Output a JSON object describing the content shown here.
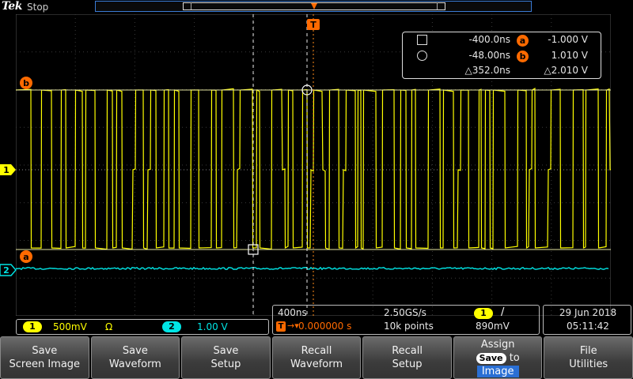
{
  "header": {
    "logo": "Tek",
    "run_state": "Stop"
  },
  "colors": {
    "ch1": "#ffff00",
    "ch2": "#00e5e5",
    "cursor_accent": "#ff6a00",
    "record_view_border": "#3a7bd5",
    "image_chip": "#2a6fd4"
  },
  "markers": {
    "trigger_label": "T",
    "cursor_a_label": "a",
    "cursor_b_label": "b",
    "ch1_label": "1",
    "ch2_label": "2"
  },
  "cursor_readout": {
    "a_time": "-400.0ns",
    "a_label": "a",
    "a_volt": "-1.000 V",
    "b_time": "-48.00ns",
    "b_label": "b",
    "b_volt": "1.010 V",
    "delta_time": "△352.0ns",
    "delta_volt": "△2.010 V"
  },
  "channels": {
    "ch1_label": "1",
    "ch1_scale": "500mV",
    "ch1_termination": "Ω",
    "ch2_label": "2",
    "ch2_scale": "1.00 V"
  },
  "acquisition": {
    "timebase": "400ns",
    "sample_rate": "2.50GS/s",
    "trigger_source": "1",
    "trigger_slope": "/",
    "trigger_position_icon": "T",
    "trigger_position_arrow": "→▾",
    "trigger_position": "0.000000 s",
    "record_length": "10k points",
    "trigger_level": "890mV"
  },
  "datetime": {
    "date": "29 Jun  2018",
    "time": "05:11:42"
  },
  "menu": [
    {
      "line1": "Save",
      "line2": "Screen Image"
    },
    {
      "line1": "Save",
      "line2": "Waveform"
    },
    {
      "line1": "Save",
      "line2": "Setup"
    },
    {
      "line1": "Recall",
      "line2": "Waveform"
    },
    {
      "line1": "Recall",
      "line2": "Setup"
    },
    {
      "line1": "Assign",
      "chip": "Save",
      "to": "to",
      "target": "Image"
    },
    {
      "line1": "File",
      "line2": "Utilities"
    }
  ]
}
